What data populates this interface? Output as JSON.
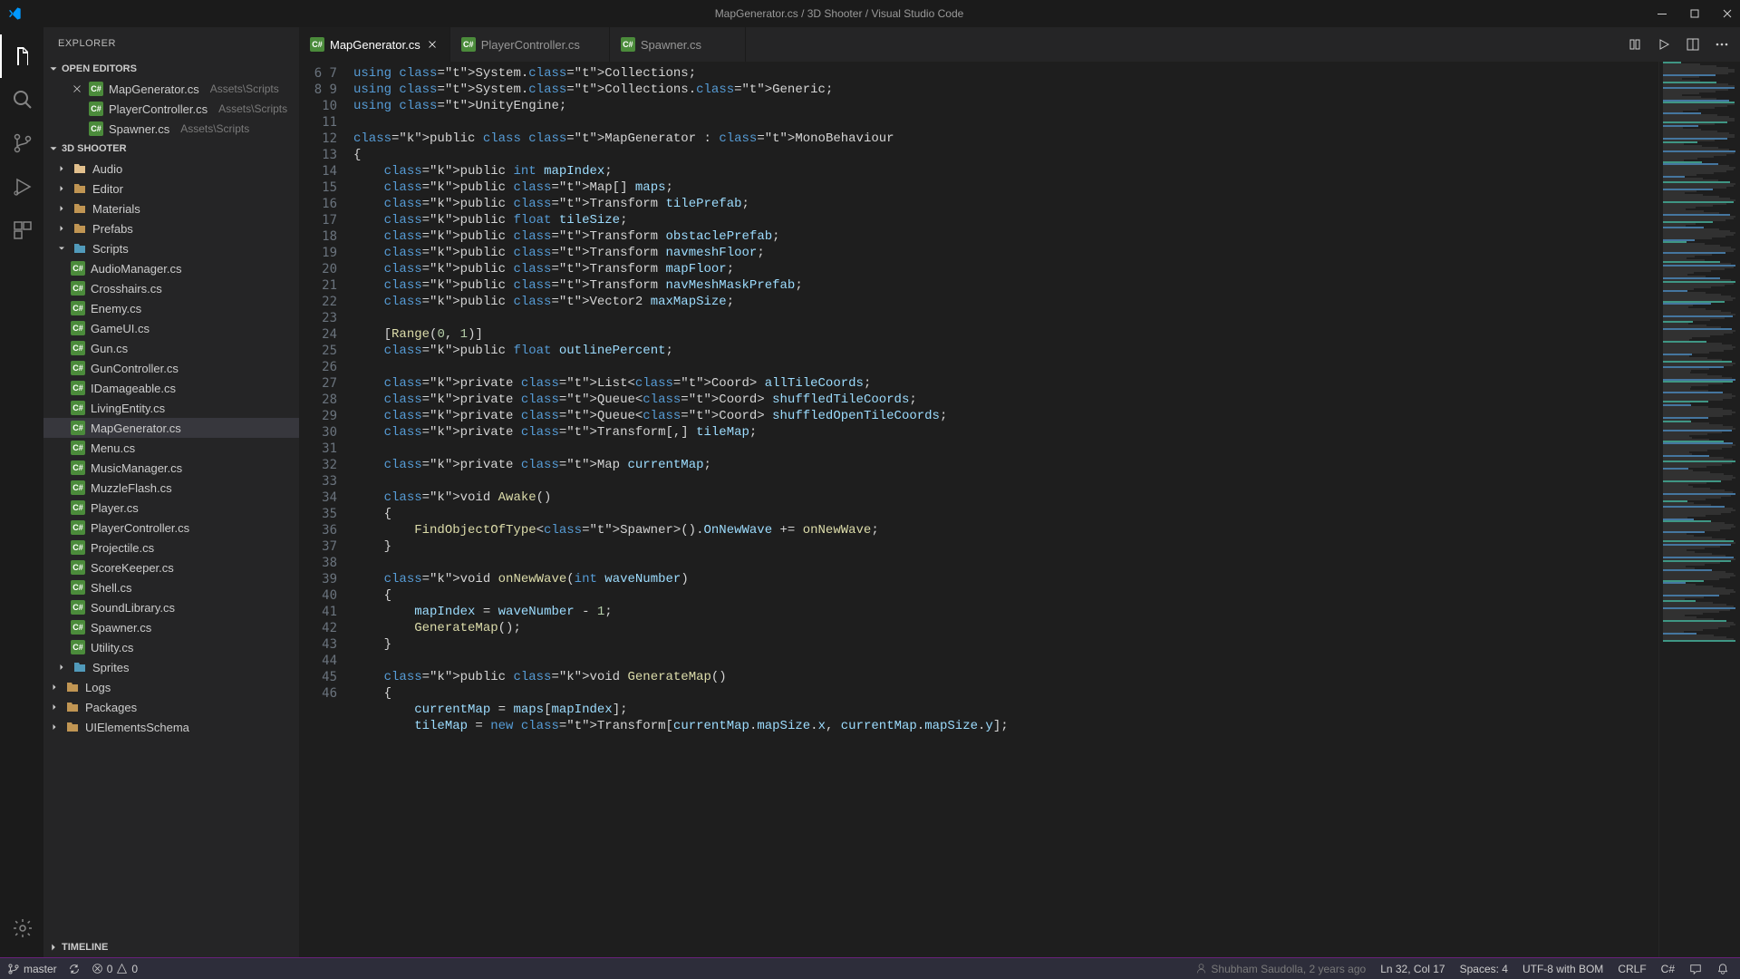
{
  "window": {
    "title": "MapGenerator.cs / 3D Shooter / Visual Studio Code"
  },
  "sidebar": {
    "title": "EXPLORER",
    "openEditorsLabel": "OPEN EDITORS",
    "openEditors": [
      {
        "name": "MapGenerator.cs",
        "path": "Assets\\Scripts",
        "active": true
      },
      {
        "name": "PlayerController.cs",
        "path": "Assets\\Scripts",
        "active": false
      },
      {
        "name": "Spawner.cs",
        "path": "Assets\\Scripts",
        "active": false
      }
    ],
    "projectName": "3D SHOOTER",
    "tree": [
      {
        "type": "folder",
        "name": "Audio",
        "color": "orange"
      },
      {
        "type": "folder",
        "name": "Editor"
      },
      {
        "type": "folder",
        "name": "Materials"
      },
      {
        "type": "folder",
        "name": "Prefabs"
      },
      {
        "type": "folder",
        "name": "Scripts",
        "open": true,
        "color": "blue",
        "children": [
          "AudioManager.cs",
          "Crosshairs.cs",
          "Enemy.cs",
          "GameUI.cs",
          "Gun.cs",
          "GunController.cs",
          "IDamageable.cs",
          "LivingEntity.cs",
          "MapGenerator.cs",
          "Menu.cs",
          "MusicManager.cs",
          "MuzzleFlash.cs",
          "Player.cs",
          "PlayerController.cs",
          "Projectile.cs",
          "ScoreKeeper.cs",
          "Shell.cs",
          "SoundLibrary.cs",
          "Spawner.cs",
          "Utility.cs"
        ]
      },
      {
        "type": "folder",
        "name": "Sprites",
        "color": "blue"
      },
      {
        "type": "folder",
        "name": "Logs",
        "top": true
      },
      {
        "type": "folder",
        "name": "Packages",
        "top": true
      },
      {
        "type": "folder",
        "name": "UIElementsSchema",
        "top": true
      }
    ],
    "timelineLabel": "TIMELINE"
  },
  "tabs": [
    {
      "label": "MapGenerator.cs",
      "active": true
    },
    {
      "label": "PlayerController.cs",
      "active": false
    },
    {
      "label": "Spawner.cs",
      "active": false
    }
  ],
  "code": {
    "startLine": 6,
    "lines": [
      "using System.Collections;",
      "using System.Collections.Generic;",
      "using UnityEngine;",
      "",
      "public class MapGenerator : MonoBehaviour",
      "{",
      "    public int mapIndex;",
      "    public Map[] maps;",
      "    public Transform tilePrefab;",
      "    public float tileSize;",
      "    public Transform obstaclePrefab;",
      "    public Transform navmeshFloor;",
      "    public Transform mapFloor;",
      "    public Transform navMeshMaskPrefab;",
      "    public Vector2 maxMapSize;",
      "",
      "    [Range(0, 1)]",
      "    public float outlinePercent;",
      "",
      "    private List<Coord> allTileCoords;",
      "    private Queue<Coord> shuffledTileCoords;",
      "    private Queue<Coord> shuffledOpenTileCoords;",
      "    private Transform[,] tileMap;",
      "",
      "    private Map currentMap;",
      "",
      "    void Awake()",
      "    {",
      "        FindObjectOfType<Spawner>().OnNewWave += onNewWave;",
      "    }",
      "",
      "    void onNewWave(int waveNumber)",
      "    {",
      "        mapIndex = waveNumber - 1;",
      "        GenerateMap();",
      "    }",
      "",
      "    public void GenerateMap()",
      "    {",
      "        currentMap = maps[mapIndex];",
      "        tileMap = new Transform[currentMap.mapSize.x, currentMap.mapSize.y];"
    ]
  },
  "blame": "Shubham Saudolla, 2 years ago",
  "status": {
    "branch": "master",
    "sync": "⟳",
    "errors": "0",
    "warnings": "0",
    "cursor": "Ln 32, Col 17",
    "spaces": "Spaces: 4",
    "encoding": "UTF-8 with BOM",
    "eol": "CRLF",
    "lang": "C#"
  }
}
